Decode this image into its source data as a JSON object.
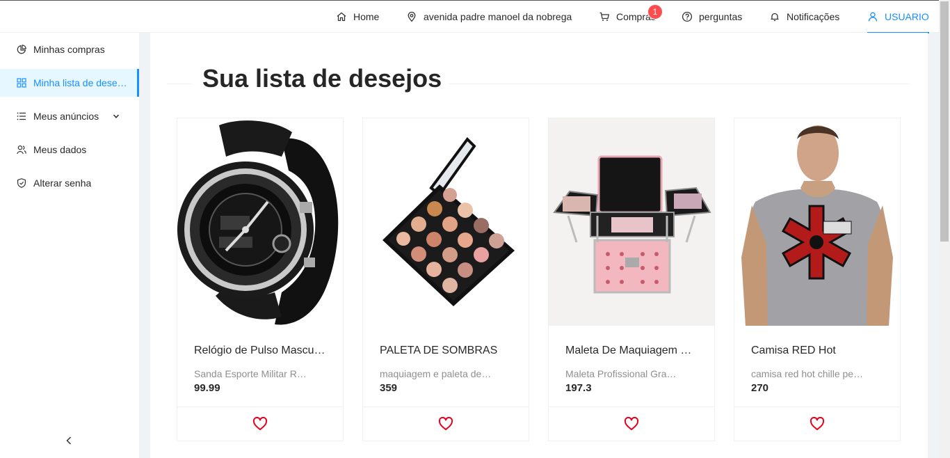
{
  "header": {
    "home": "Home",
    "address": "avenida padre manoel da nobrega",
    "purchases": "Compras",
    "purchases_badge": "1",
    "questions": "perguntas",
    "notifications": "Notificações",
    "user": "USUARIO"
  },
  "sidebar": {
    "items": [
      {
        "label": "Minhas compras",
        "icon": "pie-chart-icon"
      },
      {
        "label": "Minha lista de desejos",
        "icon": "appstore-icon"
      },
      {
        "label": "Meus anúncios",
        "icon": "unordered-list-icon"
      },
      {
        "label": "Meus dados",
        "icon": "team-icon"
      },
      {
        "label": "Alterar senha",
        "icon": "safety-icon"
      }
    ]
  },
  "main": {
    "title": "Sua lista de desejos",
    "products": [
      {
        "name": "Relógio de Pulso Masculino",
        "description": "Sanda Esporte Militar Resistente",
        "price": "99.99"
      },
      {
        "name": "PALETA DE SOMBRAS",
        "description": "maquiagem e paleta de sombras",
        "price": "359"
      },
      {
        "name": "Maleta De Maquiagem Completa",
        "description": "Maleta Profissional Grande",
        "price": "197.3"
      },
      {
        "name": "Camisa RED Hot",
        "description": "camisa red hot chille peppers",
        "price": "270"
      }
    ]
  },
  "colors": {
    "accent": "#1890ff",
    "badge": "#ff4d4f",
    "heart": "#e8001c"
  }
}
